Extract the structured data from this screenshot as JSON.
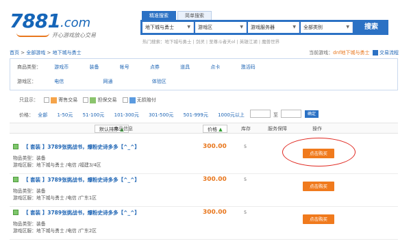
{
  "logo": {
    "number": "7881",
    "domain": ".com",
    "slogan": "开心游戏放心交易"
  },
  "search": {
    "tabs": [
      "精准搜索",
      "简单搜索"
    ],
    "selects": [
      "地下城与勇士",
      "游戏区",
      "游戏服务器",
      "全部类别"
    ],
    "button": "搜索",
    "hot": "热门搜索：地下城与勇士 | 剑灵 | 至尊斗者天ol | 英雄江湖 | 魔兽世界"
  },
  "breadcrumb": {
    "home": "首页",
    "sep": " > ",
    "all": "全部游戏",
    "game": "地下城与勇士"
  },
  "location": {
    "prefix": "当前游戏：",
    "current": "dnf地下城与勇士",
    "guarantee": "交易流程"
  },
  "filter": {
    "type_label": "商品类型：",
    "types": [
      "游戏币",
      "装备",
      "帐号",
      "点券",
      "道具",
      "点卡",
      "激活码"
    ],
    "zone_label": "游戏区：",
    "zones": [
      "电信",
      "网通",
      "体验区"
    ]
  },
  "options": {
    "label": "只显示：",
    "items": [
      "寄售交易",
      "担保交易",
      "无损赔付"
    ]
  },
  "price": {
    "label": "价格：",
    "ranges": [
      "全部",
      "1-50元",
      "51-100元",
      "101-300元",
      "301-500元",
      "501-999元",
      "1000元以上"
    ],
    "to": "至",
    "confirm": "确定"
  },
  "table": {
    "sort_default": "默认排序",
    "col_info": "商品信息",
    "col_price": "价格",
    "col_stock": "库存",
    "col_guarantee": "服务保障",
    "col_action": "操作"
  },
  "listings": [
    {
      "title": "【 套装 】3789张挑战书，爆粉史诗多多【^_^】",
      "type_label": "物品类型：",
      "type": "装备",
      "zone_label": "游戏区服：",
      "zone": "地下城与勇士 /电信 /福建3/4区",
      "price": "300.00",
      "stock": "5",
      "buy": "点击购买"
    },
    {
      "title": "【 套装 】3789张挑战书，爆粉史诗多多【^_^】",
      "type_label": "物品类型：",
      "type": "装备",
      "zone_label": "游戏区服：",
      "zone": "地下城与勇士 /电信 /广东1区",
      "price": "300.00",
      "stock": "5",
      "buy": "点击购买"
    },
    {
      "title": "【 套装 】3789张挑战书，爆粉史诗多多【^_^】",
      "type_label": "物品类型：",
      "type": "装备",
      "zone_label": "游戏区服：",
      "zone": "地下城与勇士 /电信 /广东2区",
      "price": "300.00",
      "stock": "5",
      "buy": "点击购买"
    }
  ],
  "colors": {
    "brand": "#2b71c4",
    "accent": "#f07a1d",
    "highlight": "#e0271f"
  }
}
